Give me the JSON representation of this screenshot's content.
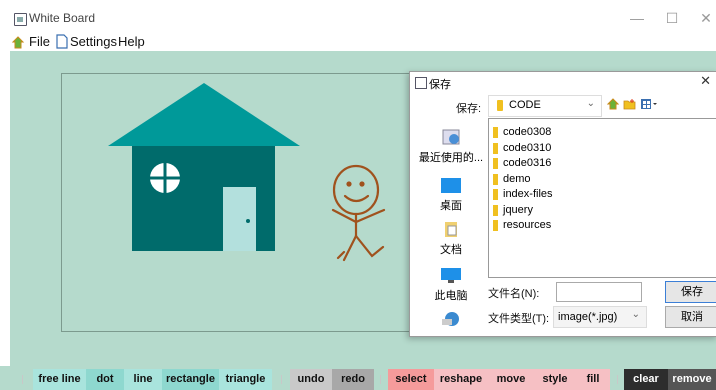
{
  "window": {
    "title": "White Board",
    "minimize_glyph": "—",
    "maximize_glyph": "☐",
    "close_glyph": "✕"
  },
  "menu": {
    "file": "File",
    "settings": "Settings",
    "help": "Help"
  },
  "toolbar": {
    "buttons": [
      {
        "label": "free line",
        "color": "#a9e4dd"
      },
      {
        "label": "dot",
        "color": "#8ed8cf"
      },
      {
        "label": "line",
        "color": "#a9e4dd"
      },
      {
        "label": "rectangle",
        "color": "#8ed8cf"
      },
      {
        "label": "triangle",
        "color": "#a9e4dd"
      },
      {
        "label": "undo",
        "color": "#c9c9c9"
      },
      {
        "label": "redo",
        "color": "#a8a8a8"
      },
      {
        "label": "select",
        "color": "#f59b9b"
      },
      {
        "label": "reshape",
        "color": "#f6c0c4"
      },
      {
        "label": "move",
        "color": "#f6c0c4"
      },
      {
        "label": "style",
        "color": "#f6c0c4"
      },
      {
        "label": "fill",
        "color": "#f6c0c4"
      },
      {
        "label": "clear",
        "color": "#2d2d2d"
      },
      {
        "label": "remove",
        "color": "#555555"
      }
    ]
  },
  "dialog": {
    "title": "保存",
    "close_glyph": "✕",
    "save_in_label": "保存:",
    "save_in_value": "CODE",
    "places": [
      "最近使用的...",
      "桌面",
      "文档",
      "此电脑",
      ""
    ],
    "files": [
      "code0308",
      "code0310",
      "code0316",
      "demo",
      "index-files",
      "jquery",
      "resources"
    ],
    "filename_label": "文件名(N):",
    "filename_value": "",
    "filetype_label": "文件类型(T):",
    "filetype_value": "image(*.jpg)",
    "save_button": "保存",
    "cancel_button": "取消"
  },
  "colors": {
    "background": "#b5dacc",
    "roof": "#009999",
    "house": "#006b6b",
    "door": "#b3e0dd",
    "stickman": "#a0521d"
  }
}
